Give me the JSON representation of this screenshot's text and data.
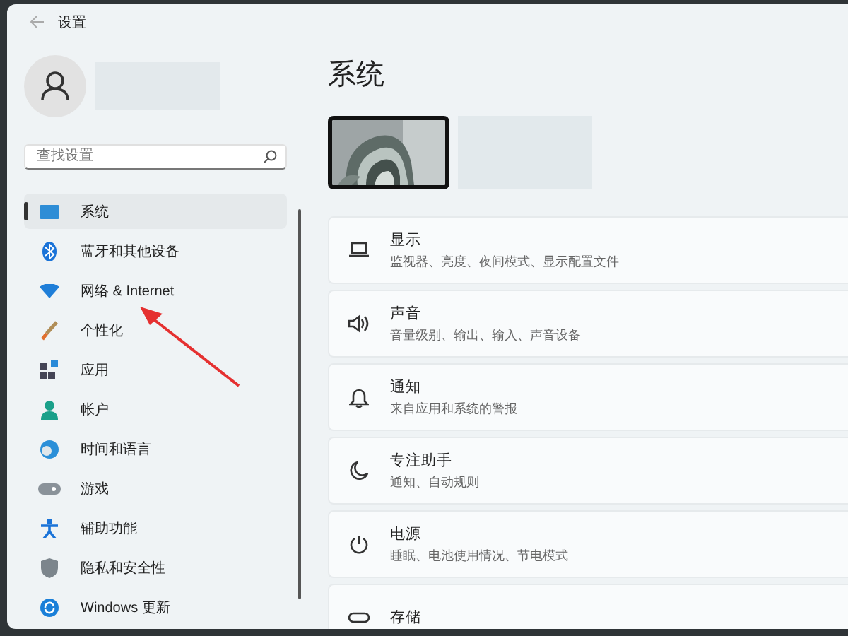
{
  "window": {
    "title": "设置"
  },
  "sidebar": {
    "search": {
      "placeholder": "查找设置"
    },
    "items": [
      {
        "label": "系统",
        "selected": true
      },
      {
        "label": "蓝牙和其他设备",
        "selected": false
      },
      {
        "label": "网络 & Internet",
        "selected": false
      },
      {
        "label": "个性化",
        "selected": false
      },
      {
        "label": "应用",
        "selected": false
      },
      {
        "label": "帐户",
        "selected": false
      },
      {
        "label": "时间和语言",
        "selected": false
      },
      {
        "label": "游戏",
        "selected": false
      },
      {
        "label": "辅助功能",
        "selected": false
      },
      {
        "label": "隐私和安全性",
        "selected": false
      },
      {
        "label": "Windows 更新",
        "selected": false
      }
    ]
  },
  "main": {
    "heading": "系统",
    "cards": [
      {
        "title": "显示",
        "subtitle": "监视器、亮度、夜间模式、显示配置文件"
      },
      {
        "title": "声音",
        "subtitle": "音量级别、输出、输入、声音设备"
      },
      {
        "title": "通知",
        "subtitle": "来自应用和系统的警报"
      },
      {
        "title": "专注助手",
        "subtitle": "通知、自动规则"
      },
      {
        "title": "电源",
        "subtitle": "睡眠、电池使用情况、节电模式"
      },
      {
        "title": "存储"
      }
    ]
  }
}
